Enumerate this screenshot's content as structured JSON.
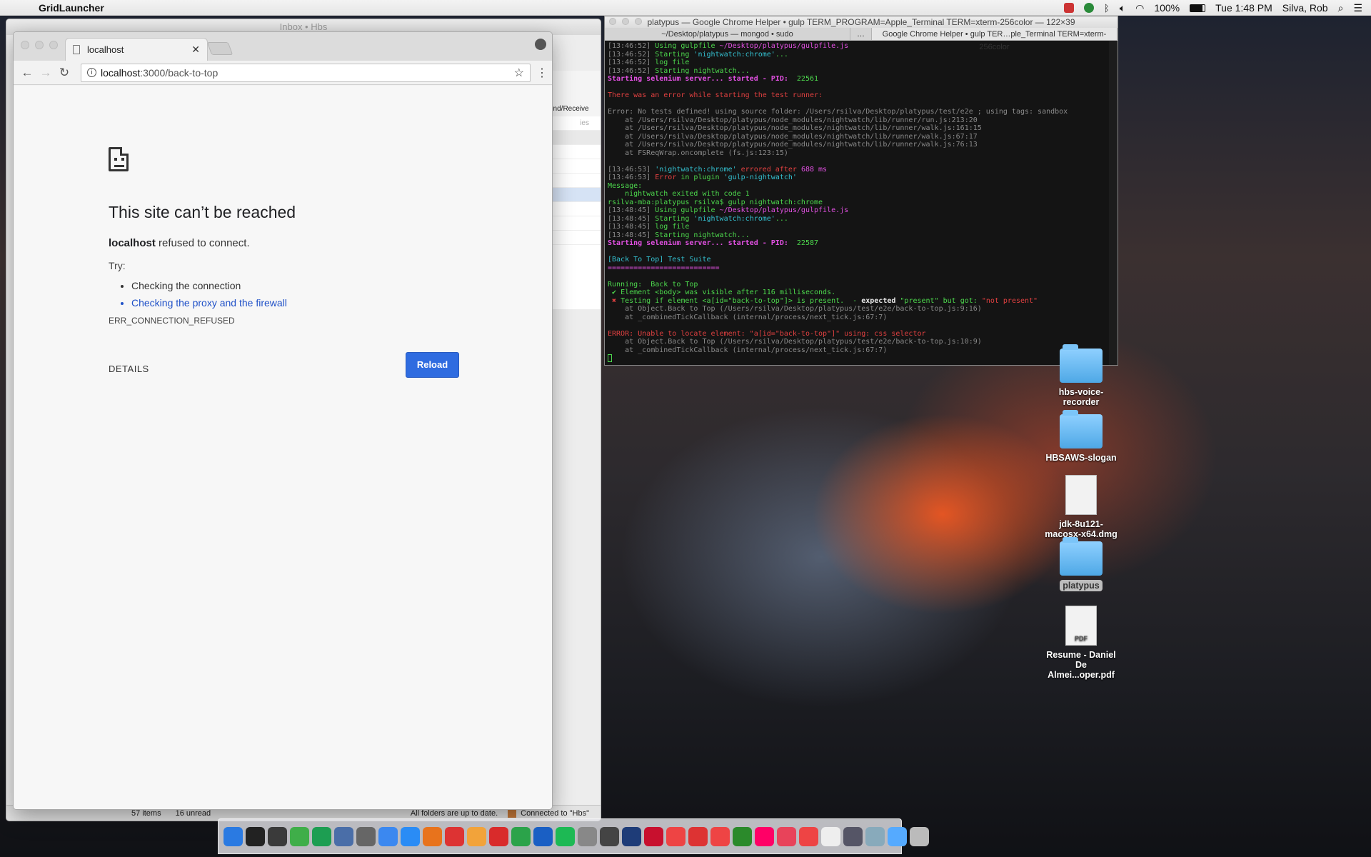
{
  "menubar": {
    "app_name": "GridLauncher",
    "battery": "100%",
    "clock": "Tue 1:48 PM",
    "user": "Silva, Rob"
  },
  "outlook": {
    "title": "Inbox • Hbs",
    "send_receive": "end/Receive",
    "filter_label": "ies",
    "status_items": "57 items",
    "status_unread": "16 unread",
    "status_sync": "All folders are up to date.",
    "status_connected": "Connected to \"Hbs\""
  },
  "chrome": {
    "tab_title": "localhost",
    "url_host": "localhost",
    "url_path": ":3000/back-to-top",
    "error": {
      "title": "This site can’t be reached",
      "host": "localhost",
      "message": " refused to connect.",
      "try_label": "Try:",
      "suggestions": [
        "Checking the connection",
        "Checking the proxy and the firewall"
      ],
      "code": "ERR_CONNECTION_REFUSED",
      "details": "DETAILS",
      "reload": "Reload"
    }
  },
  "terminal": {
    "title": "platypus — Google Chrome Helper • gulp TERM_PROGRAM=Apple_Terminal TERM=xterm-256color — 122×39",
    "tabs": [
      "~/Desktop/platypus — mongod • sudo",
      "…",
      "Google Chrome Helper • gulp TER…ple_Terminal TERM=xterm-256color"
    ],
    "lines": [
      [
        {
          "t": "[13:46:52] ",
          "c": "gr"
        },
        {
          "t": "Using gulpfile ",
          "c": "g"
        },
        {
          "t": "~/Desktop/platypus/gulpfile.js",
          "c": "m"
        }
      ],
      [
        {
          "t": "[13:46:52] ",
          "c": "gr"
        },
        {
          "t": "Starting ",
          "c": "g"
        },
        {
          "t": "'nightwatch:chrome'",
          "c": "c"
        },
        {
          "t": "...",
          "c": "g"
        }
      ],
      [
        {
          "t": "[13:46:52] ",
          "c": "gr"
        },
        {
          "t": "log file",
          "c": "g"
        }
      ],
      [
        {
          "t": "[13:46:52] ",
          "c": "gr"
        },
        {
          "t": "Starting nightwatch...",
          "c": "g"
        }
      ],
      [
        {
          "t": "Starting selenium server... started - PID:  ",
          "c": "m b"
        },
        {
          "t": "22561",
          "c": "g"
        }
      ],
      [
        {
          "t": "",
          "c": ""
        }
      ],
      [
        {
          "t": "There was an error while starting the test runner:",
          "c": "r"
        }
      ],
      [
        {
          "t": "",
          "c": ""
        }
      ],
      [
        {
          "t": "Error: No tests defined! using source folder: /Users/rsilva/Desktop/platypus/test/e2e ; using tags: sandbox",
          "c": "gr"
        }
      ],
      [
        {
          "t": "    at /Users/rsilva/Desktop/platypus/node_modules/nightwatch/lib/runner/run.js:213:20",
          "c": "gr"
        }
      ],
      [
        {
          "t": "    at /Users/rsilva/Desktop/platypus/node_modules/nightwatch/lib/runner/walk.js:161:15",
          "c": "gr"
        }
      ],
      [
        {
          "t": "    at /Users/rsilva/Desktop/platypus/node_modules/nightwatch/lib/runner/walk.js:67:17",
          "c": "gr"
        }
      ],
      [
        {
          "t": "    at /Users/rsilva/Desktop/platypus/node_modules/nightwatch/lib/runner/walk.js:76:13",
          "c": "gr"
        }
      ],
      [
        {
          "t": "    at FSReqWrap.oncomplete (fs.js:123:15)",
          "c": "gr"
        }
      ],
      [
        {
          "t": "",
          "c": ""
        }
      ],
      [
        {
          "t": "[13:46:53] ",
          "c": "gr"
        },
        {
          "t": "'nightwatch:chrome'",
          "c": "c"
        },
        {
          "t": " errored after ",
          "c": "r"
        },
        {
          "t": "688 ms",
          "c": "m"
        }
      ],
      [
        {
          "t": "[13:46:53] ",
          "c": "gr"
        },
        {
          "t": "Error",
          "c": "r"
        },
        {
          "t": " in plugin ",
          "c": "g"
        },
        {
          "t": "'gulp-nightwatch'",
          "c": "c"
        }
      ],
      [
        {
          "t": "Message:",
          "c": "g"
        }
      ],
      [
        {
          "t": "    nightwatch exited with code 1",
          "c": "g"
        }
      ],
      [
        {
          "t": "rsilva-mba:platypus rsilva$ gulp nightwatch:chrome",
          "c": "g"
        }
      ],
      [
        {
          "t": "[13:48:45] ",
          "c": "gr"
        },
        {
          "t": "Using gulpfile ",
          "c": "g"
        },
        {
          "t": "~/Desktop/platypus/gulpfile.js",
          "c": "m"
        }
      ],
      [
        {
          "t": "[13:48:45] ",
          "c": "gr"
        },
        {
          "t": "Starting ",
          "c": "g"
        },
        {
          "t": "'nightwatch:chrome'",
          "c": "c"
        },
        {
          "t": "...",
          "c": "g"
        }
      ],
      [
        {
          "t": "[13:48:45] ",
          "c": "gr"
        },
        {
          "t": "log file",
          "c": "g"
        }
      ],
      [
        {
          "t": "[13:48:45] ",
          "c": "gr"
        },
        {
          "t": "Starting nightwatch...",
          "c": "g"
        }
      ],
      [
        {
          "t": "Starting selenium server... started - PID:  ",
          "c": "m b"
        },
        {
          "t": "22587",
          "c": "g"
        }
      ],
      [
        {
          "t": "",
          "c": ""
        }
      ],
      [
        {
          "t": "[Back To Top] Test Suite",
          "c": "c"
        }
      ],
      [
        {
          "t": "==========================",
          "c": "m"
        }
      ],
      [
        {
          "t": "",
          "c": ""
        }
      ],
      [
        {
          "t": "Running:  ",
          "c": "g"
        },
        {
          "t": "Back to Top",
          "c": "g"
        }
      ],
      [
        {
          "t": " ✔ ",
          "c": "g"
        },
        {
          "t": "Element <body> was visible after 116 milliseconds.",
          "c": "g"
        }
      ],
      [
        {
          "t": " ✖ ",
          "c": "r"
        },
        {
          "t": "Testing if element <a[id=\"back-to-top\"]> is present.  - ",
          "c": "g"
        },
        {
          "t": "expected ",
          "c": "w b"
        },
        {
          "t": "\"present\"",
          "c": "g"
        },
        {
          "t": " but got: ",
          "c": "g"
        },
        {
          "t": "\"not present\"",
          "c": "r"
        }
      ],
      [
        {
          "t": "    at Object.Back to Top (/Users/rsilva/Desktop/platypus/test/e2e/back-to-top.js:9:16)",
          "c": "gr"
        }
      ],
      [
        {
          "t": "    at _combinedTickCallback (internal/process/next_tick.js:67:7)",
          "c": "gr"
        }
      ],
      [
        {
          "t": "",
          "c": ""
        }
      ],
      [
        {
          "t": "ERROR: Unable to locate element: \"a[id=\"back-to-top\"]\" using: css selector",
          "c": "r"
        }
      ],
      [
        {
          "t": "    at Object.Back to Top (/Users/rsilva/Desktop/platypus/test/e2e/back-to-top.js:10:9)",
          "c": "gr"
        }
      ],
      [
        {
          "t": "    at _combinedTickCallback (internal/process/next_tick.js:67:7)",
          "c": "gr"
        }
      ]
    ]
  },
  "desktop": {
    "icons": [
      {
        "label": "hbs-voice-recorder",
        "kind": "folder"
      },
      {
        "label": "HBSAWS-slogan",
        "kind": "folder"
      },
      {
        "label": "jdk-8u121-macosx-x64.dmg",
        "kind": "file"
      },
      {
        "label": "platypus",
        "kind": "folder",
        "selected": true
      },
      {
        "label": "Resume - Daniel De Almei...oper.pdf",
        "kind": "file",
        "badge": "PDF"
      }
    ]
  },
  "dock": {
    "colors": [
      "#2a7ae2",
      "#222",
      "#3a3a3a",
      "#3fae49",
      "#1d9e52",
      "#4a6ea8",
      "#666",
      "#3b88f0",
      "#2a8cf5",
      "#e8731c",
      "#d33",
      "#f2a33a",
      "#d92b2b",
      "#2ba34a",
      "#1a5fc4",
      "#1db954",
      "#888",
      "#444",
      "#1e3c78",
      "#c8102e",
      "#e44",
      "#d33",
      "#e44",
      "#2b8a2b",
      "#f06",
      "#e8435a",
      "#e44",
      "#eee",
      "#556",
      "#8ab",
      "#5af",
      "#bbb"
    ]
  }
}
